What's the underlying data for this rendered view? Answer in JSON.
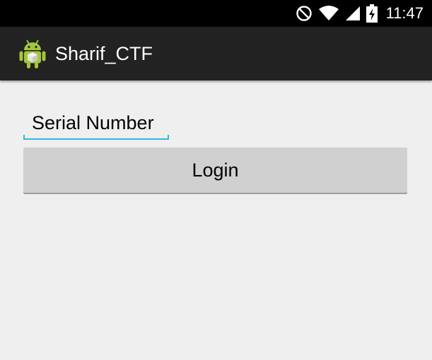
{
  "status_bar": {
    "time": "11:47",
    "icons": [
      "do-not-disturb-icon",
      "wifi-icon",
      "signal-icon",
      "battery-charging-icon"
    ]
  },
  "action_bar": {
    "title": "Sharif_CTF",
    "icon": "android-app-icon"
  },
  "form": {
    "serial_field_text": "Serial Number",
    "login_label": "Login"
  },
  "colors": {
    "status_bar": "#000000",
    "action_bar": "#222222",
    "background": "#efefef",
    "accent": "#33b5e5",
    "button": "#d0d0d0",
    "android_green": "#a4c639"
  }
}
